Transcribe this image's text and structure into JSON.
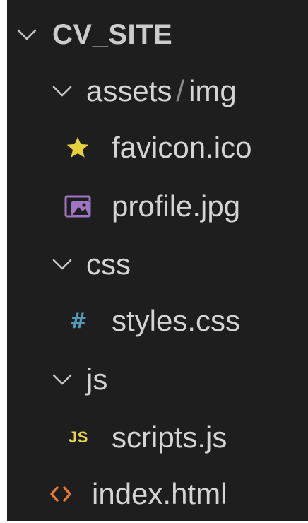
{
  "explorer": {
    "root": {
      "label": "CV_SITE",
      "expanded": true
    },
    "folders": {
      "assets": {
        "label": "assets",
        "separator": "/",
        "sub_label": "img",
        "expanded": true
      },
      "css": {
        "label": "css",
        "expanded": true
      },
      "js": {
        "label": "js",
        "expanded": true
      }
    },
    "files": {
      "favicon": {
        "label": "favicon.ico",
        "icon": "star-icon"
      },
      "profile": {
        "label": "profile.jpg",
        "icon": "image-icon"
      },
      "styles": {
        "label": "styles.css",
        "icon": "hash-icon",
        "glyph": "#"
      },
      "scripts": {
        "label": "scripts.js",
        "icon": "js-icon",
        "glyph": "JS"
      },
      "index": {
        "label": "index.html",
        "icon": "html-icon"
      }
    }
  },
  "colors": {
    "background": "#1e1e1e",
    "text": "#d4d4d4",
    "star": "#e6d23a",
    "image": "#a074c4",
    "css": "#519aba",
    "js": "#e8d44d",
    "html": "#e37933"
  }
}
